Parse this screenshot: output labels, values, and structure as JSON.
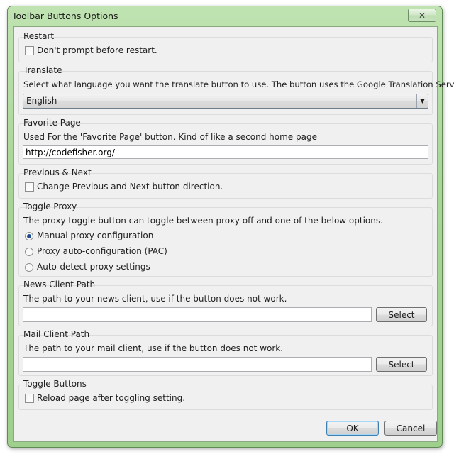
{
  "window": {
    "title": "Toolbar Buttons Options",
    "close_glyph": "✕"
  },
  "restart": {
    "title": "Restart",
    "checkbox_label": "Don't prompt before restart."
  },
  "translate": {
    "title": "Translate",
    "description": "Select what language you want the translate button to use. The button uses the Google Translation Service",
    "selected": "English",
    "arrow": "▼"
  },
  "favorite": {
    "title": "Favorite Page",
    "description": "Used For the 'Favorite Page' button. Kind of like a second home page",
    "value": "http://codefisher.org/"
  },
  "prevnext": {
    "title": "Previous & Next",
    "checkbox_label": "Change Previous and Next button direction."
  },
  "proxy": {
    "title": "Toggle Proxy",
    "description": "The proxy toggle button can toggle between proxy off and one of the below options.",
    "options": [
      "Manual proxy configuration",
      "Proxy auto-configuration (PAC)",
      "Auto-detect proxy settings"
    ],
    "selected_index": 0
  },
  "news": {
    "title": "News Client Path",
    "description": "The path to your news client, use if the button does not work.",
    "value": "",
    "select_label": "Select"
  },
  "mail": {
    "title": "Mail Client Path",
    "description": "The path to your mail client, use if the button does not work.",
    "value": "",
    "select_label": "Select"
  },
  "toggle": {
    "title": "Toggle Buttons",
    "checkbox_label": "Reload page after toggling setting."
  },
  "footer": {
    "ok_label": "OK",
    "cancel_label": "Cancel"
  }
}
